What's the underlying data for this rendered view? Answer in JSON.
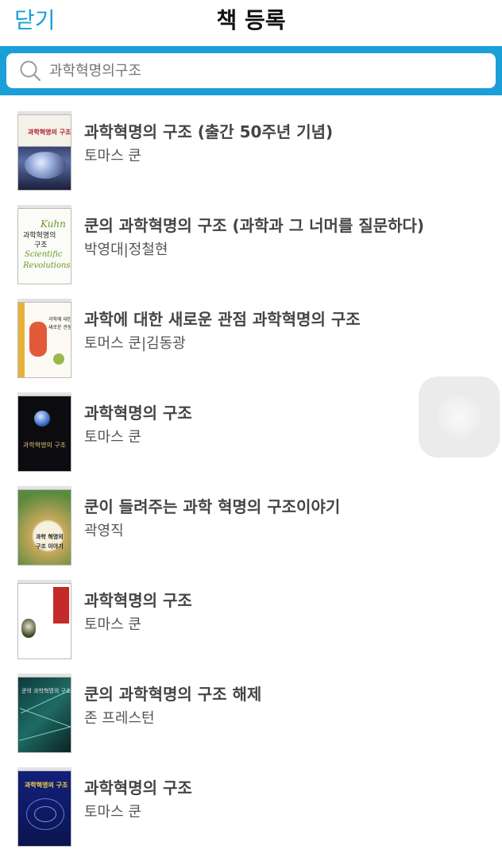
{
  "header": {
    "close_label": "닫기",
    "title": "책 등록"
  },
  "search": {
    "placeholder": "과학혁명의구조",
    "icon": "search-icon"
  },
  "books": [
    {
      "title": "과학혁명의 구조 (출간 50주년 기념)",
      "author": "토마스 쿤"
    },
    {
      "title": "쿤의 과학혁명의 구조 (과학과 그 너머를 질문하다)",
      "author": "박영대|정철현"
    },
    {
      "title": "과학에 대한 새로운 관점 과학혁명의 구조",
      "author": "토머스 쿤|김동광"
    },
    {
      "title": "과학혁명의 구조",
      "author": "토마스 쿤"
    },
    {
      "title": "쿤이 들려주는 과학 혁명의 구조이야기",
      "author": "곽영직"
    },
    {
      "title": "과학혁명의 구조",
      "author": "토마스 쿤"
    },
    {
      "title": "쿤의 과학혁명의 구조 해제",
      "author": "존 프레스턴"
    },
    {
      "title": "과학혁명의 구조",
      "author": "토마스 쿤"
    }
  ],
  "colors": {
    "accent": "#1a9fd9"
  }
}
